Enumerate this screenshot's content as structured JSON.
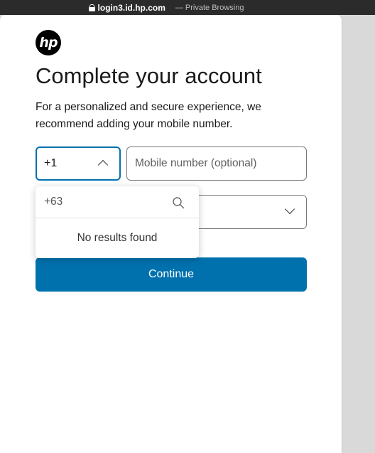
{
  "browser": {
    "domain": "login3.id.hp.com",
    "mode_label": "— Private Browsing"
  },
  "logo": {
    "text": "hp",
    "icon": "hp-logo-icon"
  },
  "page": {
    "title": "Complete your account",
    "subtitle": "For a personalized and secure experience, we recommend adding your mobile number."
  },
  "country_code": {
    "selected": "+1"
  },
  "mobile": {
    "placeholder": "Mobile number (optional)",
    "value": ""
  },
  "dropdown": {
    "search_value": "+63",
    "no_results": "No results found"
  },
  "continue": {
    "label": "Continue"
  },
  "colors": {
    "accent": "#0171ad",
    "text": "#1a1a1a",
    "border": "#7a7a7a"
  }
}
